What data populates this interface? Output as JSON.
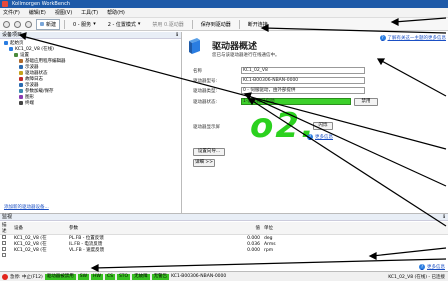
{
  "window": {
    "title": "Kollmorgen WorkBench"
  },
  "menu": [
    "文件(F)",
    "编辑(E)",
    "视图(V)",
    "工具(T)",
    "帮助(H)"
  ],
  "toolbar": {
    "new_label": "新建",
    "mode_label": "0 - 服务",
    "position_mode_label": "2 - 位置模式",
    "disable_label": "禁用 0.驱动器",
    "save_label": "保存到驱动器",
    "disconnect_label": "断开连接"
  },
  "left_pane": {
    "header": "设备项目",
    "pin": "ℹ",
    "tree": [
      {
        "label": "起始页",
        "indent": 0,
        "color": "#2a7de1"
      },
      {
        "label": "KC1_02_V8 (在线)",
        "indent": 1,
        "color": "#2a7de1"
      },
      {
        "label": "设置",
        "indent": 2,
        "color": "#4a8a3a"
      },
      {
        "label": "基础应用程序编辑器",
        "indent": 3,
        "color": "#b06a2a"
      },
      {
        "label": "示波器",
        "indent": 3,
        "color": "#2a6ab0"
      },
      {
        "label": "驱动器状态",
        "indent": 3,
        "color": "#c4a21a"
      },
      {
        "label": "故障日志",
        "indent": 3,
        "color": "#c02a2a"
      },
      {
        "label": "示波器",
        "indent": 3,
        "color": "#2a6ab0"
      },
      {
        "label": "参数加载/保存",
        "indent": 3,
        "color": "#3a8ab0"
      },
      {
        "label": "图形",
        "indent": 3,
        "color": "#8a3ab0"
      },
      {
        "label": "终端",
        "indent": 3,
        "color": "#444444"
      }
    ],
    "footer_link": "添加新的驱动器设备..."
  },
  "main": {
    "help_link": "了解有关这一主题的更多信息",
    "title": "驱动器概述",
    "subtitle": "您已与该驱动器进行在线通信中。",
    "fields": [
      {
        "label": "名称",
        "value": "KC1_02_V8"
      },
      {
        "label": "驱动器型号:",
        "value": "KC1-B00306-NBAN-0000"
      },
      {
        "label": "驱动器类型:",
        "value": "0 - 伺服驱动，由外部提供"
      },
      {
        "label": "驱动器状态:",
        "value": "1-驱动器已启动"
      }
    ],
    "disable_button": "禁用",
    "display_label": "驱动器显示屏",
    "display_value": "o2.",
    "flash_button": "闪烁",
    "more_info": "更多信息",
    "settings_button": "设置向导...",
    "details_button": "详细 >>"
  },
  "watch": {
    "header": "监视",
    "pin": "ℹ",
    "columns": [
      "描述",
      "设备",
      "参数",
      "值",
      "单位"
    ],
    "rows": [
      {
        "device": "KC1_02_V8 (在",
        "param": "PL.FB - 位置反馈",
        "value": "0.000",
        "unit": "deg"
      },
      {
        "device": "KC1_02_V8 (在",
        "param": "IL.FB - 电流反馈",
        "value": "0.036",
        "unit": "Arms"
      },
      {
        "device": "KC1_02_V8 (在",
        "param": "VL.FB - 速度反馈",
        "value": "0.000",
        "unit": "rpm"
      }
    ],
    "help_link": "更多信息"
  },
  "status": {
    "stop_label": "急停: 中止(F12)",
    "badges": [
      "驱动器被禁用",
      "SW",
      "HW",
      "CS",
      "STO",
      "无故障",
      "无警告"
    ],
    "model": "KC1-B00306-NBAN-0000",
    "right_text": "KC1_02_V8 (在线) - 已连接"
  }
}
